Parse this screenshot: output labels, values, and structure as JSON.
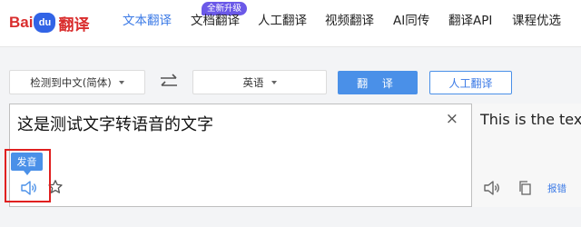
{
  "brand": {
    "logo_part1": "Bai",
    "logo_paw": "du",
    "logo_part2": "翻译"
  },
  "nav": {
    "promo_badge": "全新升级",
    "items": [
      {
        "label": "文本翻译",
        "active": true
      },
      {
        "label": "文档翻译"
      },
      {
        "label": "人工翻译"
      },
      {
        "label": "视频翻译"
      },
      {
        "label": "AI同传"
      },
      {
        "label": "翻译API"
      },
      {
        "label": "课程优选"
      }
    ]
  },
  "controls": {
    "source_lang": "检测到中文(简体)",
    "target_lang": "英语",
    "swap_icon": "swap-arrows-icon",
    "translate_label": "翻 译",
    "human_label": "人工翻译"
  },
  "source": {
    "text": "这是测试文字转语音的文字",
    "clear_symbol": "×",
    "tooltip": "发音"
  },
  "target": {
    "text": "This is the text used for testing text-to-speech",
    "report_label": "报错"
  },
  "colors": {
    "accent": "#4a90e8",
    "highlight": "#e02020",
    "brand_red": "#d92d2d",
    "badge": "#6b59e8"
  }
}
